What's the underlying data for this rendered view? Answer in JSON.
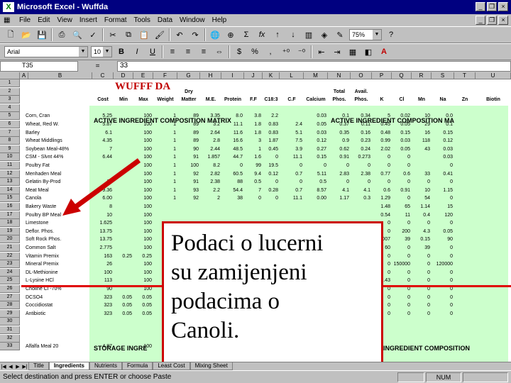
{
  "window": {
    "title": "Microsoft Excel - Wuffda",
    "app_icon": "X"
  },
  "menu": [
    "File",
    "Edit",
    "View",
    "Insert",
    "Format",
    "Tools",
    "Data",
    "Window",
    "Help"
  ],
  "toolbar": {
    "zoom": "75%",
    "font": "Arial",
    "size": "10"
  },
  "formula": {
    "name_box": "T35",
    "sign": "=",
    "value": "33"
  },
  "columns": [
    "A",
    "B",
    "C",
    "D",
    "E",
    "F",
    "G",
    "H",
    "I",
    "J",
    "K",
    "L",
    "M",
    "N",
    "O",
    "P",
    "Q",
    "R",
    "S",
    "T",
    "U"
  ],
  "sheet": {
    "title": "WUFFF DA",
    "header_row2": [
      "Dry",
      "Total",
      "Avail."
    ],
    "header_row3": [
      "Cost",
      "Min",
      "Max",
      "Weight",
      "Matter",
      "M.E.",
      "Protein",
      "F.F",
      "C18:3",
      "C.F",
      "Calcium",
      "Phos.",
      "Phos.",
      "K",
      "Cl",
      "Mn",
      "Na",
      "Zn",
      "Biotin"
    ],
    "banner1": "ACTIVE INGREDIENT COMPOSITION MATRIX",
    "banner2": "ACTIVE INGREDIENT COMPOSITION MA",
    "banner3": "STORAGE INGRE",
    "banner4": "INGREDIENT COMPOSITION",
    "row_numbers": [
      "1",
      "2",
      "3",
      "4",
      "5",
      "6",
      "7",
      "8",
      "9",
      "10",
      "11",
      "12",
      "13",
      "14",
      "15",
      "16",
      "17",
      "18",
      "19",
      "20",
      "21",
      "22",
      "23",
      "24",
      "25",
      "26",
      "27",
      "28",
      "29",
      "30",
      "31",
      "32",
      "33"
    ],
    "rows": [
      {
        "name": "Corn, Cran",
        "vals": [
          "5.25",
          "",
          "100",
          "1",
          "89",
          "3.35",
          "8.0",
          "3.8",
          "2.2",
          "",
          "0.03",
          "0.1",
          "0.34",
          "5",
          "0.02",
          "10",
          "0.0"
        ]
      },
      {
        "name": "Wheat, Red W.",
        "vals": [
          "5.87",
          "",
          "100",
          "1",
          "89",
          "3.2",
          "11.1",
          "1.8",
          "0.83",
          "2.4",
          "0.05",
          "0.37",
          "0.11",
          "0.45",
          "0.05",
          "29",
          "0.1"
        ]
      },
      {
        "name": "Barley",
        "vals": [
          "6.1",
          "",
          "100",
          "1",
          "89",
          "2.64",
          "11.6",
          "1.8",
          "0.83",
          "5.1",
          "0.03",
          "0.35",
          "0.16",
          "0.48",
          "0.15",
          "16",
          "0.15"
        ]
      },
      {
        "name": "Wheat Middlings",
        "vals": [
          "4.35",
          "",
          "100",
          "1",
          "89",
          "2.8",
          "16.6",
          "3",
          "1.87",
          "7.5",
          "0.12",
          "0.9",
          "0.23",
          "0.99",
          "0.03",
          "118",
          "0.12"
        ]
      },
      {
        "name": "Soybean Meal-48%",
        "vals": [
          "7",
          "",
          "100",
          "1",
          "90",
          "2.44",
          "48.5",
          "1",
          "0.45",
          "3.9",
          "0.27",
          "0.62",
          "0.24",
          "2.02",
          "0.05",
          "43",
          "0.03"
        ]
      },
      {
        "name": "CSM - Slvnt 44%",
        "vals": [
          "6.44",
          "",
          "100",
          "1",
          "91",
          "1.857",
          "44.7",
          "1.6",
          "0",
          "11.1",
          "0.15",
          "0.91",
          "0.273",
          "0",
          "0",
          "",
          "0.03"
        ]
      },
      {
        "name": "Poultry Fat",
        "vals": [
          "",
          "",
          "100",
          "1",
          "100",
          "8.2",
          "0",
          "99",
          "19.5",
          "0",
          "0",
          "0",
          "0",
          "0",
          "0",
          "",
          "0"
        ]
      },
      {
        "name": "Menhaden Meal",
        "vals": [
          "",
          "",
          "100",
          "1",
          "92",
          "2.82",
          "60.5",
          "9.4",
          "0.12",
          "0.7",
          "5.11",
          "2.83",
          "2.38",
          "0.77",
          "0.6",
          "33",
          "0.41"
        ]
      },
      {
        "name": "Gelatin By-Prod",
        "vals": [
          "17",
          "",
          "100",
          "1",
          "91",
          "2.38",
          "88",
          "0.5",
          "0",
          "0",
          "0.5",
          "0",
          "0",
          "0",
          "0",
          "0",
          "0"
        ]
      },
      {
        "name": "Meat Meal",
        "vals": [
          "9.36",
          "",
          "100",
          "1",
          "93",
          "2.2",
          "54.4",
          "7",
          "0.28",
          "0.7",
          "8.57",
          "4.1",
          "4.1",
          "0.6",
          "0.91",
          "10",
          "1.15"
        ]
      },
      {
        "name": "Canola",
        "vals": [
          "6.00",
          "",
          "100",
          "1",
          "92",
          "2",
          "38",
          "0",
          "0",
          "11.1",
          "0.00",
          "1.17",
          "0.3",
          "1.29",
          "0",
          "54",
          "0"
        ]
      },
      {
        "name": "Bakery Waste",
        "vals": [
          "8",
          "",
          "100",
          "",
          "",
          "",
          "",
          "",
          "",
          "",
          "",
          "",
          "",
          "1.48",
          "65",
          "1.14",
          "15"
        ]
      },
      {
        "name": "Poultry BP Meal",
        "vals": [
          "10",
          "",
          "100",
          "",
          "",
          "",
          "",
          "",
          "",
          "",
          "",
          "",
          "",
          "0.54",
          "11",
          "0.4",
          "120"
        ]
      },
      {
        "name": "Limestone",
        "vals": [
          "1.625",
          "",
          "100",
          "",
          "",
          "",
          "",
          "",
          "",
          "",
          "",
          "",
          "",
          "0",
          "0",
          "0",
          "0"
        ]
      },
      {
        "name": "Deflor. Phos.",
        "vals": [
          "13.75",
          "",
          "100",
          "",
          "",
          "",
          "",
          "",
          "",
          "",
          "",
          "",
          "",
          "0",
          "200",
          "4.3",
          "0.05"
        ]
      },
      {
        "name": "Soft Rock Phos.",
        "vals": [
          "13.75",
          "",
          "100",
          "",
          "",
          "",
          "",
          "",
          "",
          "",
          "",
          "",
          "",
          "0.007",
          "39",
          "0.15",
          "90"
        ]
      },
      {
        "name": "Common Salt",
        "vals": [
          "2.775",
          "",
          "100",
          "",
          "",
          "",
          "",
          "",
          "",
          "",
          "",
          "",
          "",
          "60",
          "0",
          "39",
          "0"
        ]
      },
      {
        "name": "Vitamin Premix",
        "vals": [
          "163",
          "0.25",
          "0.25",
          "",
          "",
          "",
          "",
          "",
          "",
          "",
          "",
          "",
          "",
          "0",
          "0",
          "0",
          "0"
        ]
      },
      {
        "name": "Mineral Premix",
        "vals": [
          "26",
          "",
          "100",
          "",
          "",
          "",
          "",
          "",
          "",
          "",
          "",
          "",
          "",
          "0",
          "150000",
          "0",
          "120000"
        ]
      },
      {
        "name": "DL-Methionine",
        "vals": [
          "100",
          "",
          "100",
          "",
          "",
          "",
          "",
          "",
          "",
          "",
          "",
          "",
          "",
          "0",
          "0",
          "0",
          "0"
        ]
      },
      {
        "name": "L-Lysine HCl",
        "vals": [
          "113",
          "",
          "100",
          "",
          "",
          "",
          "",
          "",
          "",
          "",
          "",
          "",
          "",
          "19.43",
          "0",
          "0",
          "0"
        ]
      },
      {
        "name": "Choline Cl -70%",
        "vals": [
          "90",
          "",
          "100",
          "",
          "",
          "",
          "",
          "",
          "",
          "",
          "",
          "",
          "",
          "0",
          "0",
          "0",
          "0"
        ]
      },
      {
        "name": "DCSO4",
        "vals": [
          "323",
          "0.05",
          "0.05",
          "",
          "",
          "",
          "",
          "",
          "",
          "",
          "",
          "",
          "",
          "0",
          "0",
          "0",
          "0"
        ]
      },
      {
        "name": "Coccidiostat",
        "vals": [
          "323",
          "0.05",
          "0.05",
          "",
          "",
          "",
          "",
          "",
          "",
          "",
          "",
          "",
          "",
          "0",
          "0",
          "0",
          "0"
        ]
      },
      {
        "name": "Antibiotic",
        "vals": [
          "323",
          "0.05",
          "0.05",
          "",
          "",
          "",
          "",
          "",
          "",
          "",
          "",
          "",
          "",
          "0",
          "0",
          "0",
          "0"
        ]
      }
    ],
    "storage_row": {
      "name": "Alfalfa Meal 20",
      "vals": [
        "4.87",
        "",
        "100"
      ]
    }
  },
  "overlay_text": [
    "Podaci o lucerni",
    "su zamijenjeni",
    "podacima o",
    "Canoli."
  ],
  "tabs": [
    "Title",
    "Ingredients",
    "Nutrients",
    "Formula",
    "Least Cost",
    "Mixing Sheet"
  ],
  "status": {
    "message": "Select destination and press ENTER or choose Paste",
    "num": "NUM"
  },
  "colors": {
    "title_bg": "#000080",
    "green_fill": "#ccffcc",
    "red": "#cc0000"
  }
}
